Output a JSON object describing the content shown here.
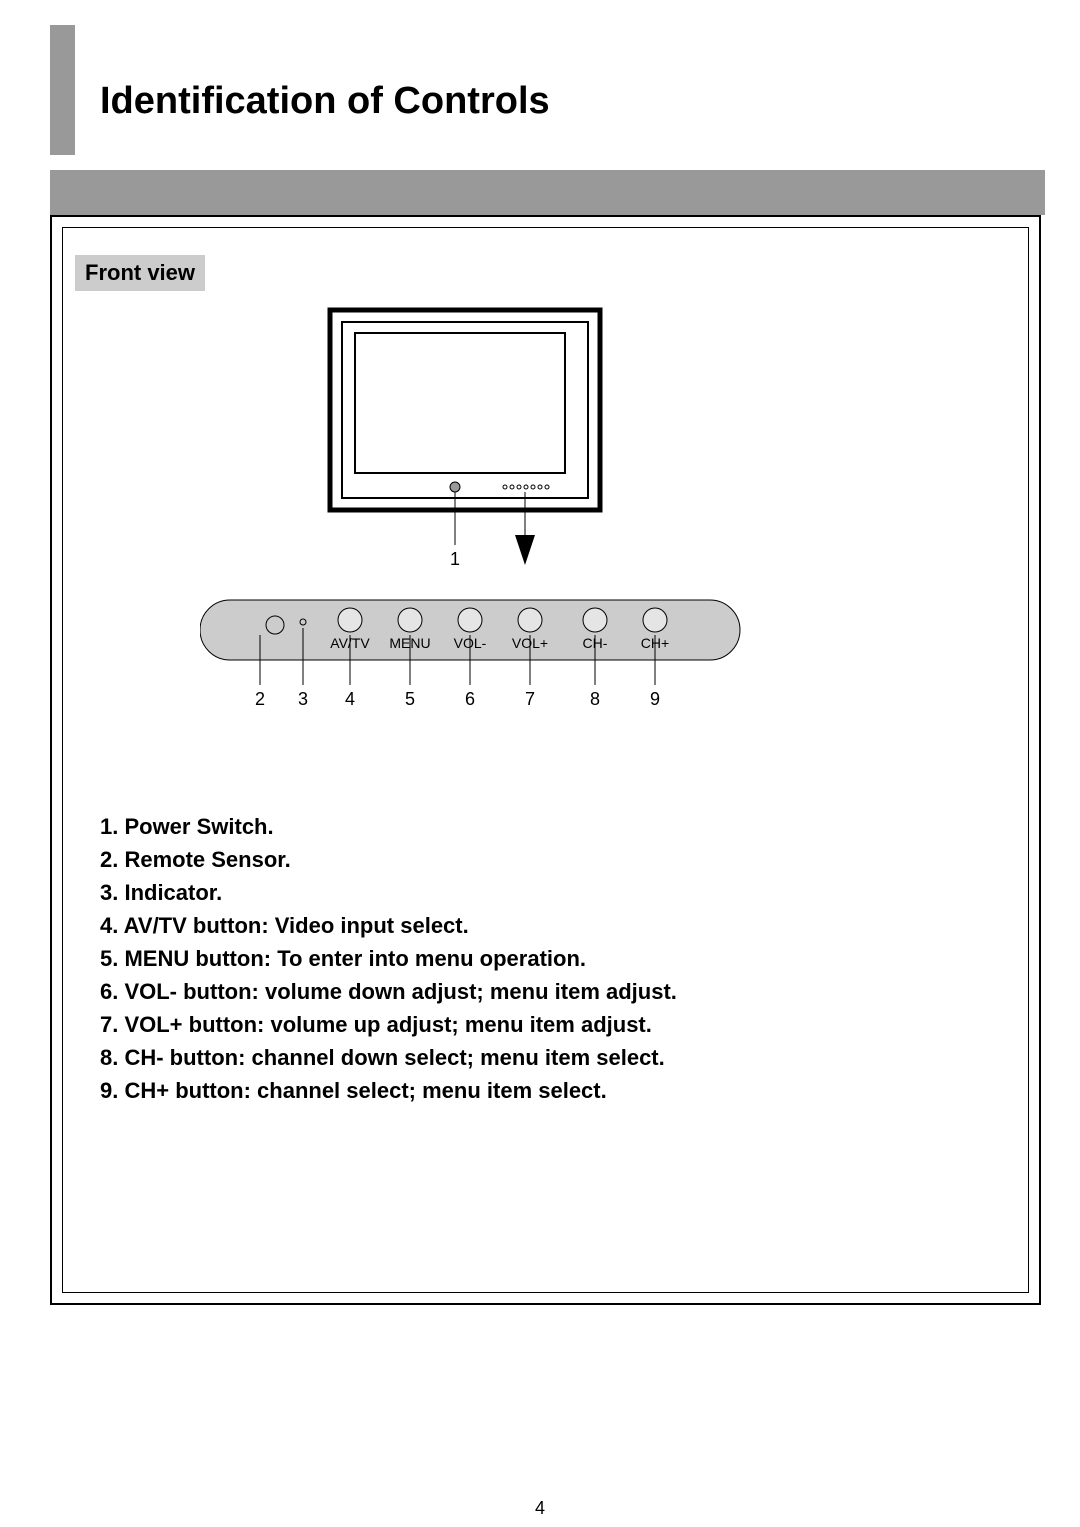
{
  "title": "Identification of Controls",
  "badge": "Front view",
  "panel": {
    "labels": [
      "AV/TV",
      "MENU",
      "VOL-",
      "VOL+",
      "CH-",
      "CH+"
    ],
    "numbers": [
      "2",
      "3",
      "4",
      "5",
      "6",
      "7",
      "8",
      "9"
    ]
  },
  "tv_number": "1",
  "items": [
    "1. Power Switch.",
    "2. Remote Sensor.",
    "3. Indicator.",
    "4. AV/TV button: Video input select.",
    "5. MENU button: To enter into menu operation.",
    "6. VOL- button: volume down adjust; menu item adjust.",
    "7. VOL+ button: volume up adjust; menu item adjust.",
    "8. CH- button: channel down select; menu item select.",
    "9. CH+ button: channel select; menu item select."
  ],
  "page_number": "4"
}
